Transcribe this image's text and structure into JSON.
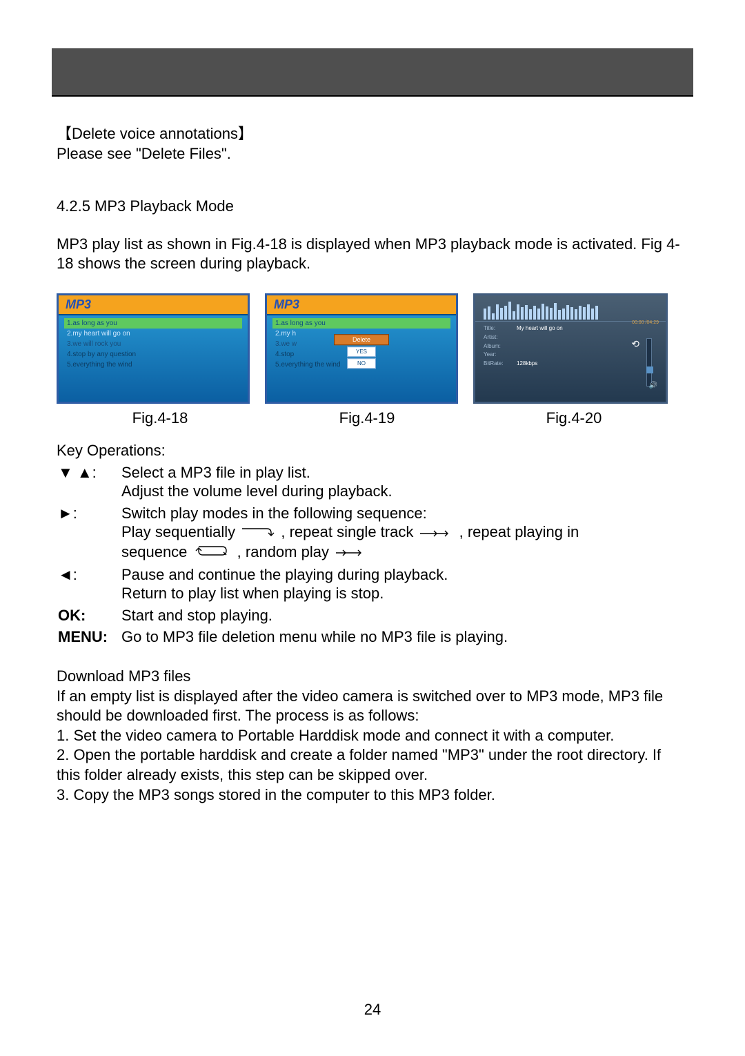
{
  "pageNumber": "24",
  "topic": {
    "title": "【Delete voice annotations】",
    "subtitle": "Please see \"Delete Files\"."
  },
  "section425": {
    "heading": "4.2.5 MP3 Playback Mode",
    "description": "MP3 play list as shown in Fig.4-18 is displayed when MP3 playback mode is activated. Fig 4-18 shows the screen during playback."
  },
  "figures": {
    "fig1": {
      "title": "MP3",
      "items": [
        "1.as long as you",
        "2.my heart will go on",
        "3.we will rock you",
        "4.stop by any question",
        "5.everything the wind"
      ],
      "caption": "Fig.4-18"
    },
    "fig2": {
      "title": "MP3",
      "items": [
        "1.as long as you",
        "2.my h",
        "3.we w",
        "4.stop",
        "5.everything the wind"
      ],
      "dialog": {
        "title": "Delete",
        "yes": "YES",
        "no": "NO"
      },
      "caption": "Fig.4-19"
    },
    "fig3": {
      "time": "00:00 /04:29",
      "meta": {
        "titleKey": "Title:",
        "titleVal": "My heart will go on",
        "artistKey": "Artist:",
        "albumKey": "Album:",
        "yearKey": "Year:",
        "bitrateKey": "BitRate:",
        "bitrateVal": "128kbps"
      },
      "caption": "Fig.4-20"
    }
  },
  "keyOps": {
    "heading": "Key Operations:",
    "row1": {
      "key": "▼ ▲:",
      "line1": "Select a MP3 file in play list.",
      "line2": "Adjust the volume level during playback."
    },
    "row2": {
      "key": "►:",
      "line1": "Switch play modes in the following sequence:",
      "seq1": "Play sequentially",
      "seq2": ", repeat single track",
      "seq3": ", repeat playing in",
      "seq4": "sequence",
      "seq5": ", random play"
    },
    "row3": {
      "key": "◄:",
      "line1": "Pause and continue the playing during playback.",
      "line2": "Return to play list when playing is stop."
    },
    "row4": {
      "key": "OK:",
      "line1": "Start and stop playing."
    },
    "row5": {
      "key": "MENU:",
      "line1": "Go to MP3 file deletion menu while no MP3 file is playing."
    }
  },
  "download": {
    "heading": "Download MP3 files",
    "intro": "If an empty list is displayed after the video camera is switched over to MP3 mode, MP3 file should be downloaded first. The process is as follows:",
    "step1": "1. Set the video camera to Portable Harddisk mode and connect it with a computer.",
    "step2": "2. Open the portable harddisk and create a folder named \"MP3\" under the root directory. If this folder already exists, this step can be skipped over.",
    "step3": "3. Copy the MP3 songs stored in the computer to this MP3 folder."
  }
}
